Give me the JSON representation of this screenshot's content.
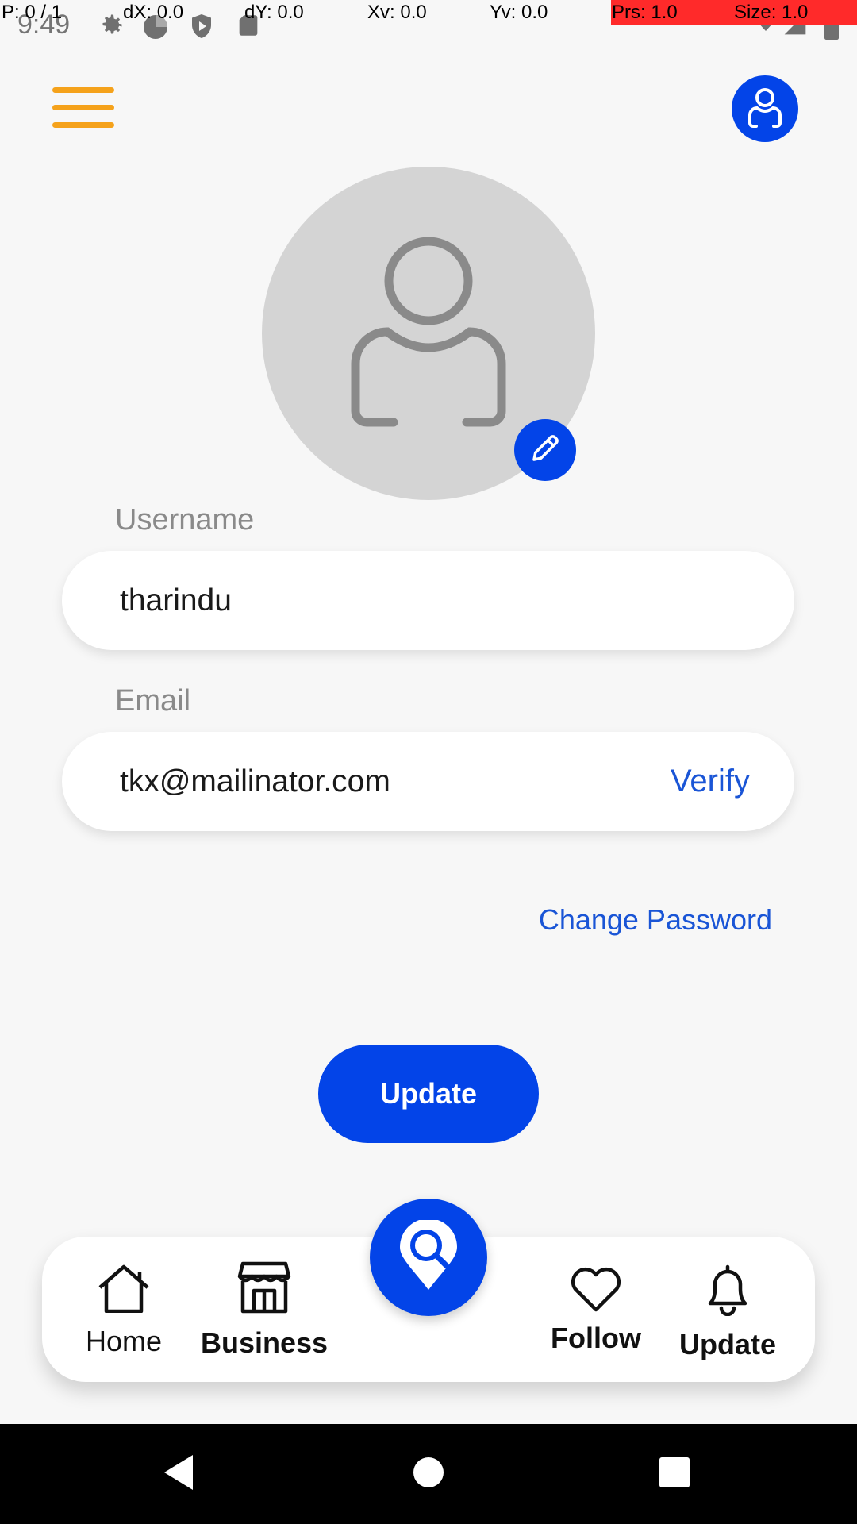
{
  "debug": {
    "p": "P: 0 / 1",
    "dx": "dX: 0.0",
    "dy": "dY: 0.0",
    "xv": "Xv: 0.0",
    "yv": "Yv: 0.0",
    "prs": "Prs: 1.0",
    "size": "Size: 1.0"
  },
  "status_bar": {
    "time": "9:49"
  },
  "profile": {
    "username_label": "Username",
    "username_value": "tharindu",
    "email_label": "Email",
    "email_value": "tkx@mailinator.com",
    "verify_label": "Verify",
    "change_password_label": "Change Password",
    "update_label": "Update"
  },
  "bottom_nav": {
    "items": [
      {
        "label": "Home",
        "icon": "home-icon"
      },
      {
        "label": "Business",
        "icon": "store-icon"
      },
      {
        "label": "Follow",
        "icon": "heart-icon"
      },
      {
        "label": "Update",
        "icon": "bell-icon"
      }
    ],
    "center_icon": "search-location-icon"
  },
  "colors": {
    "primary": "#0344e8",
    "menu_accent": "#f5a21b",
    "link": "#1a55d6",
    "background": "#f7f7f7",
    "avatar_bg": "#d4d4d4"
  }
}
